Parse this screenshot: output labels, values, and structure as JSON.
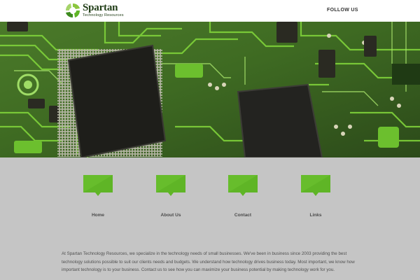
{
  "header": {
    "logo": {
      "name": "Spartan",
      "tagline": "Technology Resources"
    },
    "nav": {
      "follow_label": "FOLLOW US"
    }
  },
  "hero": {
    "image": "circuit-board-chips"
  },
  "features": [
    {
      "label": "Home",
      "icon": "speech-bubble-icon"
    },
    {
      "label": "About Us",
      "icon": "speech-bubble-icon"
    },
    {
      "label": "Contact",
      "icon": "speech-bubble-icon"
    },
    {
      "label": "Links",
      "icon": "speech-bubble-icon"
    }
  ],
  "intro": {
    "text": "At Spartan Technology Resources, we specialize in the technology needs of small businesses.    We've been in business since 2003 providing the best technology solutions possible to suit our clients needs and budgets.  We understand how technology drives business today.  Most important, we know how important technology is to your business.  Contact us to see how you can maximize your business potential by making technology work for you."
  },
  "colors": {
    "brand_green": "#5fb526",
    "brand_dark": "#1f3c15",
    "page_bg": "#c5c5c5"
  }
}
